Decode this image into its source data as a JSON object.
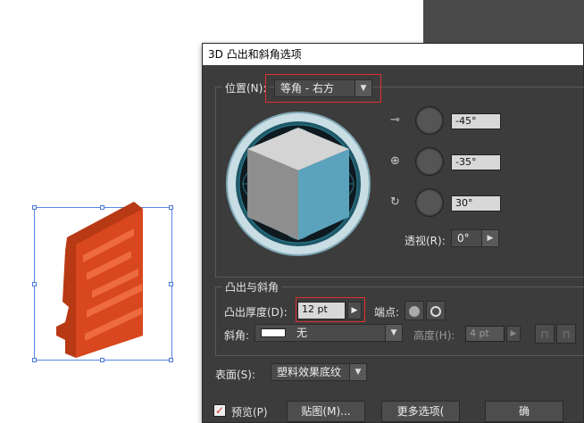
{
  "dialog": {
    "title": "3D 凸出和斜角选项",
    "position": {
      "label": "位置(N):",
      "value": "等角 - 右方"
    },
    "rotation": {
      "x": "-45°",
      "y": "-35°",
      "z": "30°"
    },
    "perspective": {
      "label": "透视(R):",
      "value": "0°"
    },
    "extrude": {
      "section_title": "凸出与斜角",
      "depth_label": "凸出厚度(D):",
      "depth_value": "12 pt",
      "cap_label": "端点:",
      "bevel_label": "斜角:",
      "bevel_value": "无",
      "height_label": "高度(H):",
      "height_value": "4 pt"
    },
    "surface": {
      "label": "表面(S):",
      "value": "塑料效果底纹"
    },
    "preview_label": "预览(P)",
    "map_button": "贴图(M)...",
    "more_options_button": "更多选项(",
    "ok_button": "确"
  },
  "colors": {
    "dialog_bg": "#3c3c3c",
    "cube_side": "#5ba3bd",
    "object": "#d9471e",
    "highlight": "#e03030"
  }
}
